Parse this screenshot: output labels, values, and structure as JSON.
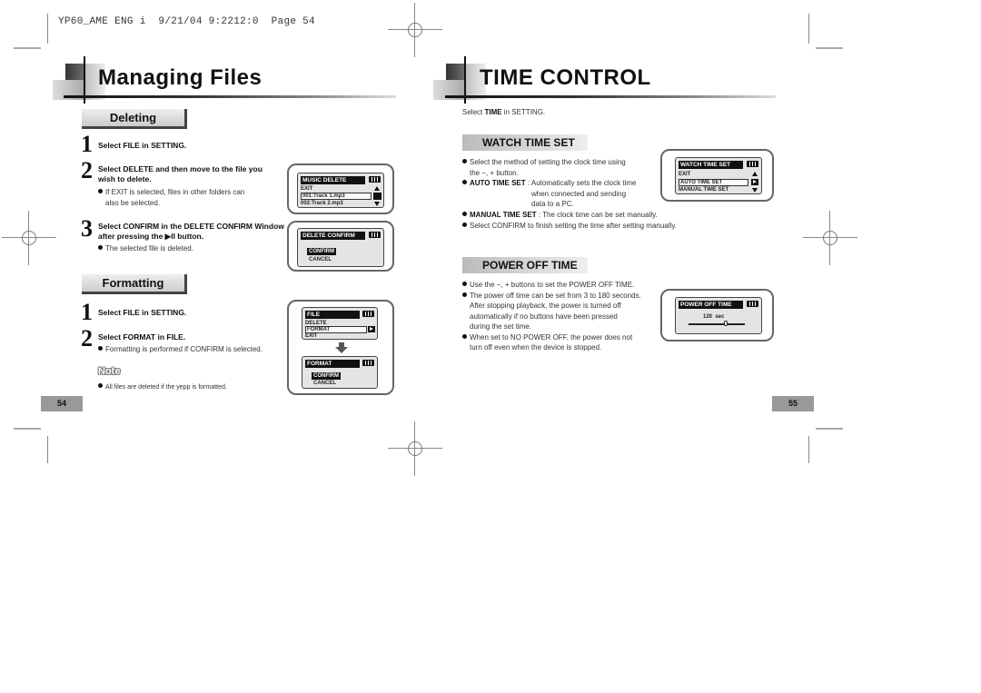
{
  "print_header": "YP60_AME ENG i  9/21/04 9:2212:0  Page 54",
  "left_page": {
    "title": "Managing Files",
    "deleting": {
      "heading": "Deleting",
      "steps": [
        {
          "num": "1",
          "text": "Select FILE in SETTING."
        },
        {
          "num": "2",
          "text_lines": [
            "Select DELETE and then move to the file you",
            "wish to delete."
          ],
          "bullet_lines": [
            "If EXIT is selected, files in other folders can",
            "also be selected."
          ]
        },
        {
          "num": "3",
          "text_lines": [
            "Select CONFIRM in the DELETE CONFIRM Window",
            "after pressing the ▶II button."
          ],
          "bullet": "The selected file is deleted."
        }
      ],
      "screen_music_delete": {
        "title": "MUSIC DELETE",
        "rows": [
          "EXIT",
          "001:Track 1.mp3",
          "002:Track 2.mp3"
        ],
        "selected_row": "001:Track 1.mp3"
      },
      "screen_delete_confirm": {
        "title": "DELETE CONFIRM",
        "options": [
          "CONFIRM",
          "CANCEL"
        ],
        "selected": "CONFIRM"
      }
    },
    "formatting": {
      "heading": "Formatting",
      "steps": [
        {
          "num": "1",
          "text": "Select FILE in SETTING."
        },
        {
          "num": "2",
          "text": "Select FORMAT in FILE.",
          "bullet": "Formatting is performed if CONFIRM is selected."
        }
      ],
      "screen_file": {
        "title": "FILE",
        "rows": [
          "DELETE",
          "FORMAT",
          "EXIT"
        ],
        "selected_row": "FORMAT"
      },
      "screen_format": {
        "title": "FORMAT",
        "options": [
          "CONFIRM",
          "CANCEL"
        ],
        "selected": "CONFIRM"
      }
    },
    "note": {
      "title": "Note",
      "text": "All files are deleted if the yepp is formatted."
    },
    "page_number": "54"
  },
  "right_page": {
    "title": "TIME CONTROL",
    "intro_prefix": "Select ",
    "intro_bold": "TIME",
    "intro_suffix": " in SETTING.",
    "watch_time_set": {
      "heading": "WATCH TIME SET",
      "bullet1_lines": [
        "Select the method of setting the clock time using",
        "the −, + button."
      ],
      "auto_label": "AUTO TIME SET",
      "auto_lines": [
        " : Automatically sets the clock time",
        "when connected and sending",
        "data to a PC."
      ],
      "manual_label": "MANUAL TIME SET",
      "manual_text": " : The clock time can be set manually.",
      "bullet_confirm": "Select CONFIRM to finish setting the time after setting manually.",
      "screen": {
        "title": "WATCH TIME SET",
        "rows": [
          "EXIT",
          "AUTO TIME SET",
          "MANUAL TIME SET"
        ],
        "selected_row": "AUTO TIME SET"
      }
    },
    "power_off_time": {
      "heading": "POWER OFF TIME",
      "bullet1": "Use the −, + buttons to set the POWER OFF TIME.",
      "bullet2_lines": [
        "The power off time can be set from 3 to 180 seconds.",
        "After stopping playback, the power is turned off",
        "automatically if no buttons have been pressed",
        "during the set time."
      ],
      "bullet3_lines": [
        "When set to NO POWER OFF, the power does not",
        "turn off even when the device is stopped."
      ],
      "screen": {
        "title": "POWER OFF TIME",
        "value_label": "120  sec",
        "slider_fraction": 0.66
      }
    },
    "page_number": "55"
  }
}
